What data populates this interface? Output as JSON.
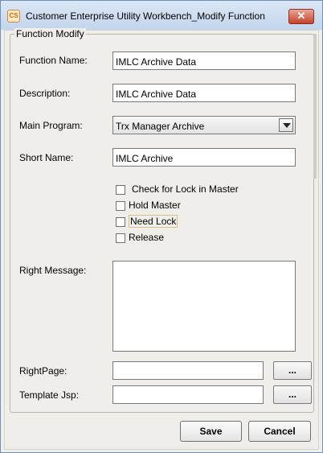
{
  "window": {
    "title": "Customer Enterprise Utility Workbench_Modify Function",
    "app_icon": "CS",
    "close_glyph": "✕"
  },
  "form": {
    "group_title": "Function Modify",
    "function_name": {
      "label": "Function Name:",
      "value": "IMLC Archive Data"
    },
    "description": {
      "label": "Description:",
      "value": "IMLC Archive Data"
    },
    "main_program": {
      "label": "Main Program:",
      "value": "Trx Manager Archive"
    },
    "short_name": {
      "label": "Short Name:",
      "value": "IMLC Archive"
    },
    "checkboxes": [
      {
        "label": "Check for Lock in Master",
        "checked": false
      },
      {
        "label": "Hold Master",
        "checked": false
      },
      {
        "label": "Need Lock",
        "checked": false
      },
      {
        "label": "Release",
        "checked": false
      }
    ],
    "right_message": {
      "label": "Right Message:",
      "value": ""
    },
    "right_page": {
      "label": "RightPage:",
      "value": "",
      "browse_label": "..."
    },
    "template_jsp": {
      "label": "Template Jsp:",
      "value": "",
      "browse_label": "..."
    }
  },
  "buttons": {
    "save": "Save",
    "cancel": "Cancel"
  }
}
